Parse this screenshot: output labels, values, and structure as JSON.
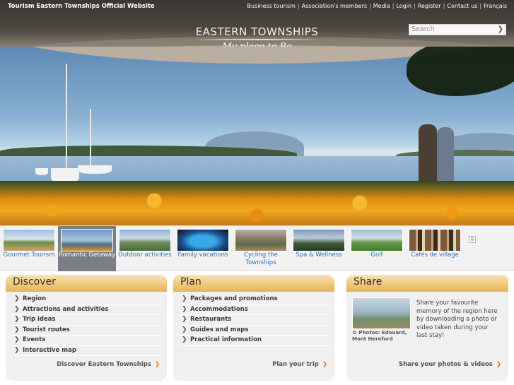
{
  "header": {
    "site_name": "Tourism Eastern Townships Official Website",
    "top_nav": [
      "Business tourism",
      "Association's members",
      "Media",
      "Login",
      "Register",
      "Contact us",
      "Français"
    ],
    "logo_line1": "EASTERN TOWNSHIPS",
    "logo_line2": "My place to Be",
    "search_placeholder": "Search"
  },
  "thumbnails": [
    {
      "label": "Gourmet Tourism",
      "active": false
    },
    {
      "label": "Romantic Getaway",
      "active": true
    },
    {
      "label": "Outdoor activities",
      "active": false
    },
    {
      "label": "Family vacations",
      "active": false
    },
    {
      "label": "Cycling the Townships",
      "active": false
    },
    {
      "label": "Spa & Wellness",
      "active": false
    },
    {
      "label": "Golf",
      "active": false
    },
    {
      "label": "Cafés de village",
      "active": false
    }
  ],
  "pause_glyph": "II",
  "discover": {
    "title": "Discover",
    "items": [
      "Region",
      "Attractions and activities",
      "Trip ideas",
      "Tourist routes",
      "Events",
      "Interactive map"
    ],
    "link": "Discover Eastern Townships"
  },
  "plan": {
    "title": "Plan",
    "items": [
      "Packages and promotions",
      "Accommodations",
      "Restaurants",
      "Guides and maps",
      "Practical information"
    ],
    "link": "Plan your trip"
  },
  "share": {
    "title": "Share",
    "credit": "© Photos: Edouard, Mont Hereford",
    "text": "Share your favourite memory of the region here by downloading a photo or video taken during your last stay!",
    "link": "Share your photos & videos"
  },
  "colors": {
    "accent_link": "#2a73c9",
    "panel_header": "#efc97c",
    "arrow_orange": "#e0701a"
  }
}
